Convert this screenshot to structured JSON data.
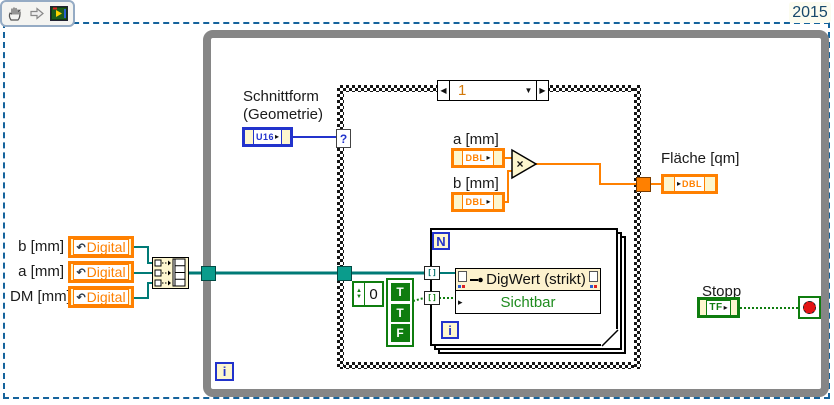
{
  "window": {
    "year_label": "2015"
  },
  "toolbar": {
    "icons": [
      "hand-tool",
      "arrow-tool",
      "buffer-tool"
    ]
  },
  "glyphs": {
    "tri_right": "▸",
    "tri_left": "◀",
    "tri_down": "▼",
    "tri_up": "▲",
    "tri_small_right": "▶",
    "brackets": "[]",
    "curved_arrow": "↶",
    "multiply": "×",
    "question": "?"
  },
  "left_controls": {
    "items": [
      {
        "label": "b [mm]",
        "text": "Digital"
      },
      {
        "label": "a [mm]",
        "text": "Digital"
      },
      {
        "label": "DM [mm]",
        "text": "Digital"
      }
    ]
  },
  "schnittform": {
    "label_line1": "Schnittform",
    "label_line2": "(Geometrie)",
    "type": "U16"
  },
  "case_structure": {
    "selector_value": "1"
  },
  "dbl_a": {
    "label": "a [mm]",
    "type": "DBL"
  },
  "dbl_b": {
    "label": "b [mm]",
    "type": "DBL"
  },
  "flaeche": {
    "label": "Fläche [qm]",
    "type": "DBL"
  },
  "bool_array": {
    "index": "0",
    "elements": [
      "T",
      "T",
      "F"
    ]
  },
  "for_loop": {
    "count": "N",
    "iterator": "i"
  },
  "property_node": {
    "title": "DigWert (strikt)",
    "property": "Sichtbar"
  },
  "while_loop": {
    "iterator": "i"
  },
  "stopp": {
    "label": "Stopp",
    "type": "TF"
  }
}
